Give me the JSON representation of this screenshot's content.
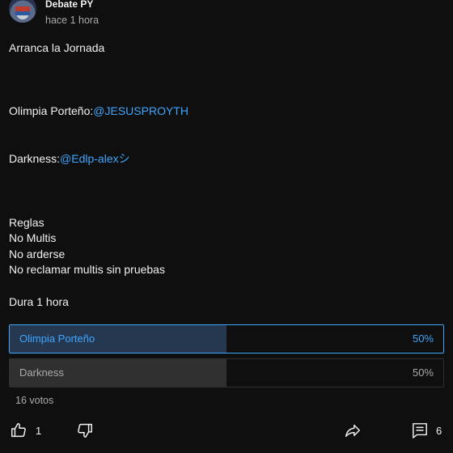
{
  "post": {
    "channel_name": "Debate PY",
    "time": "hace 1 hora",
    "lines": [
      {
        "text": "Arranca la Jornada",
        "mention": ""
      },
      {
        "text": "",
        "mention": ""
      },
      {
        "text": "",
        "mention": ""
      },
      {
        "text": "",
        "mention": ""
      },
      {
        "text": "Olimpia Porteño:",
        "mention": "@JESUSPROYTH"
      },
      {
        "text": "",
        "mention": ""
      },
      {
        "text": "",
        "mention": ""
      },
      {
        "text": "Darkness:",
        "mention": "@Edlp-alexシ"
      },
      {
        "text": "",
        "mention": ""
      },
      {
        "text": "",
        "mention": ""
      },
      {
        "text": "",
        "mention": ""
      },
      {
        "text": "Reglas",
        "mention": ""
      },
      {
        "text": "No Multis",
        "mention": ""
      },
      {
        "text": "No arderse",
        "mention": ""
      },
      {
        "text": "No reclamar multis sin pruebas",
        "mention": ""
      },
      {
        "text": "",
        "mention": ""
      },
      {
        "text": "Dura 1 hora",
        "mention": ""
      }
    ]
  },
  "poll": {
    "options": [
      {
        "label": "Olimpia Porteño",
        "percent_text": "50%",
        "fraction": 0.5,
        "selected": true
      },
      {
        "label": "Darkness",
        "percent_text": "50%",
        "fraction": 0.5,
        "selected": false
      }
    ],
    "votes": "16 votos"
  },
  "actions": {
    "like_count": "1",
    "comment_count": "6",
    "icons": [
      "thumbs-up-icon",
      "thumbs-down-icon",
      "share-icon",
      "comment-icon"
    ]
  },
  "colors": {
    "background": "#0f0f0f",
    "text": "#f1f1f1",
    "secondary_text": "#aaaaaa",
    "link": "#3ea6ff",
    "selected_fill": "#263850",
    "unselected_fill": "#303030"
  }
}
